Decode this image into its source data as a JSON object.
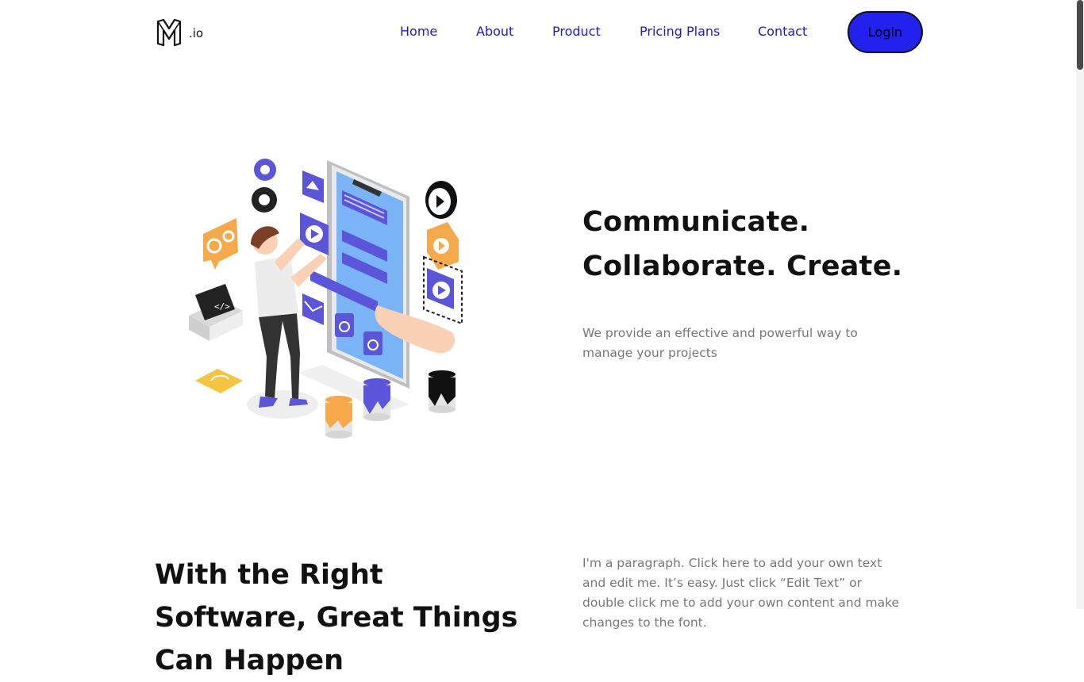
{
  "brand": {
    "logo_text": ".io",
    "logo_icon": "m-monogram-icon"
  },
  "nav": {
    "items": [
      {
        "label": "Home"
      },
      {
        "label": "About"
      },
      {
        "label": "Product"
      },
      {
        "label": "Pricing Plans"
      },
      {
        "label": "Contact"
      }
    ],
    "login_label": "Login"
  },
  "hero": {
    "title_line1": "Communicate.",
    "title_line2": "Collaborate. Create.",
    "subtitle": "We provide an effective and powerful way to manage your projects",
    "illustration": "person-building-mobile-app-illustration"
  },
  "section": {
    "title": "With the Right Software, Great Things Can Happen",
    "paragraph": "I'm a paragraph. Click here to add your own text and edit me. It’s easy. Just click “Edit Text” or double click me to add your own content and make changes to the font."
  },
  "colors": {
    "accent": "#2222ee",
    "nav_text": "#1c1cbf",
    "heading": "#111111",
    "body_text": "#777777",
    "illustration_purple": "#5b55d9",
    "illustration_orange": "#f6a94b"
  }
}
